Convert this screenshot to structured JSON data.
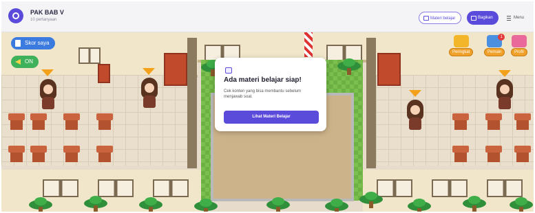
{
  "header": {
    "title": "PAK BAB V",
    "subtitle": "10 pertanyaan",
    "buttons": {
      "materi": "Materi belajar",
      "bagikan": "Bagikan",
      "menu": "Menu"
    }
  },
  "hud_left": {
    "score": "Skor saya",
    "sound": "ON"
  },
  "hud_right": {
    "leaderboard": "Peringkat",
    "players": "Pemain",
    "players_badge": "1",
    "profile": "Profil"
  },
  "modal": {
    "title": "Ada materi belajar siap!",
    "text": "Cek konten yang bisa membantu sebelum menjawab soal.",
    "button": "Lihat Materi Belajar"
  },
  "colors": {
    "accent": "#5b4bdb",
    "score_pill": "#3b7be0",
    "sound_pill": "#3fb15a",
    "hud_orange": "#f0a12a"
  },
  "icons": [
    "logo-icon",
    "book-icon",
    "share-icon",
    "menu-icon",
    "trophy-icon",
    "players-icon",
    "profile-icon",
    "speaker-icon",
    "score-icon"
  ]
}
